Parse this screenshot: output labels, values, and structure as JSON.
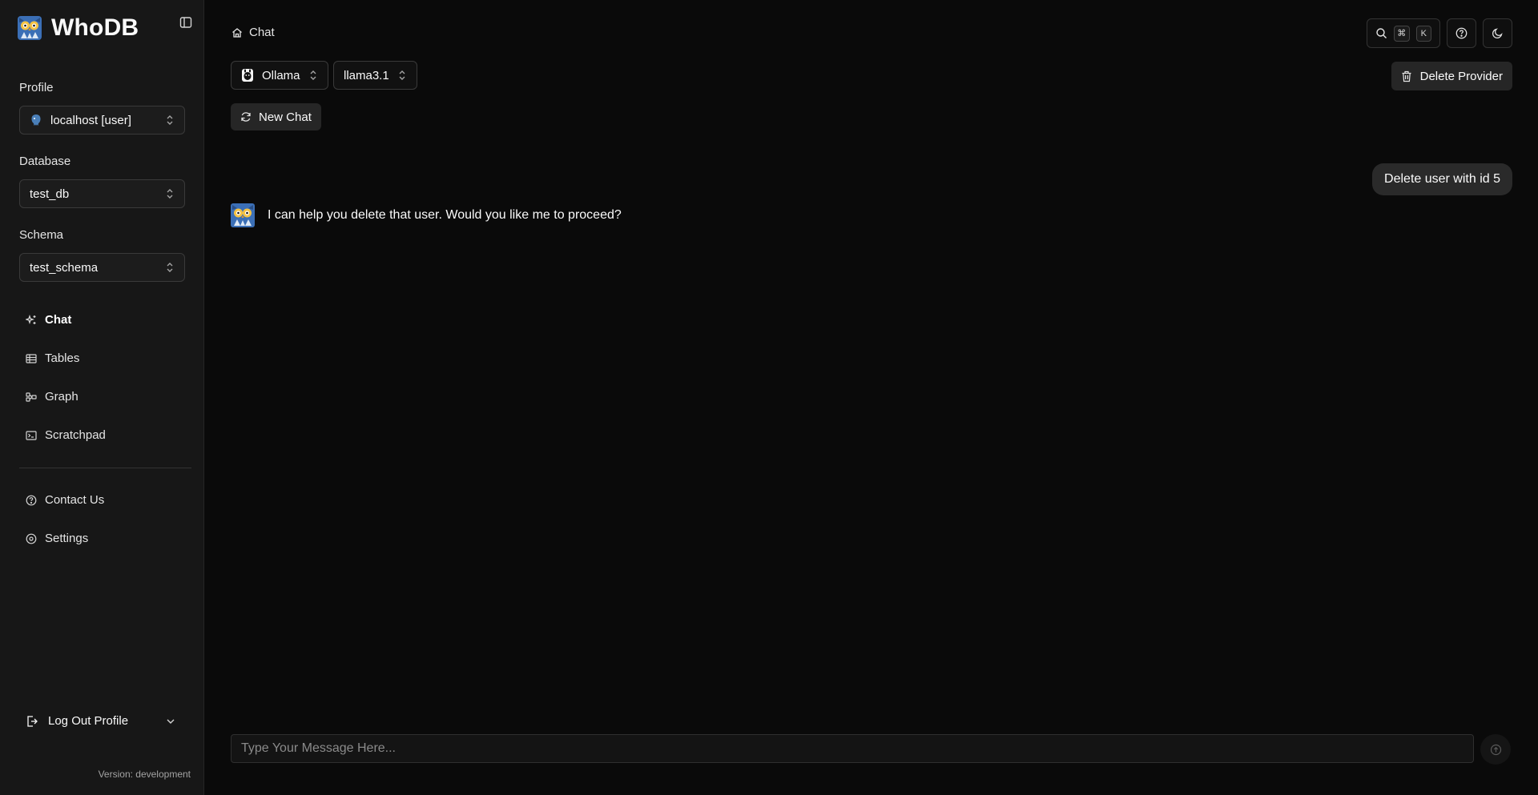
{
  "sidebar": {
    "brand": "WhoDB",
    "profile": {
      "label": "Profile",
      "value": "localhost [user]"
    },
    "database": {
      "label": "Database",
      "value": "test_db"
    },
    "schema": {
      "label": "Schema",
      "value": "test_schema"
    },
    "nav": [
      {
        "label": "Chat",
        "icon": "sparkles-icon",
        "active": true
      },
      {
        "label": "Tables",
        "icon": "table-icon"
      },
      {
        "label": "Graph",
        "icon": "graph-icon"
      },
      {
        "label": "Scratchpad",
        "icon": "terminal-icon"
      }
    ],
    "secondary_nav": [
      {
        "label": "Contact Us",
        "icon": "help-circle-icon"
      },
      {
        "label": "Settings",
        "icon": "settings-icon"
      }
    ],
    "logout_label": "Log Out Profile",
    "version": "Version: development"
  },
  "header": {
    "breadcrumb": "Chat",
    "shortcut_keys": [
      "⌘",
      "K"
    ]
  },
  "chat": {
    "provider": "Ollama",
    "model": "llama3.1",
    "delete_provider_label": "Delete Provider",
    "new_chat_label": "New Chat",
    "messages": [
      {
        "role": "user",
        "text": "Delete user with id 5"
      },
      {
        "role": "assistant",
        "text": "I can help you delete that user. Would you like me to proceed?"
      }
    ],
    "input_placeholder": "Type Your Message Here..."
  },
  "colors": {
    "background": "#0a0a0a",
    "sidebar": "#171717",
    "bubble": "#2a2a2a"
  }
}
